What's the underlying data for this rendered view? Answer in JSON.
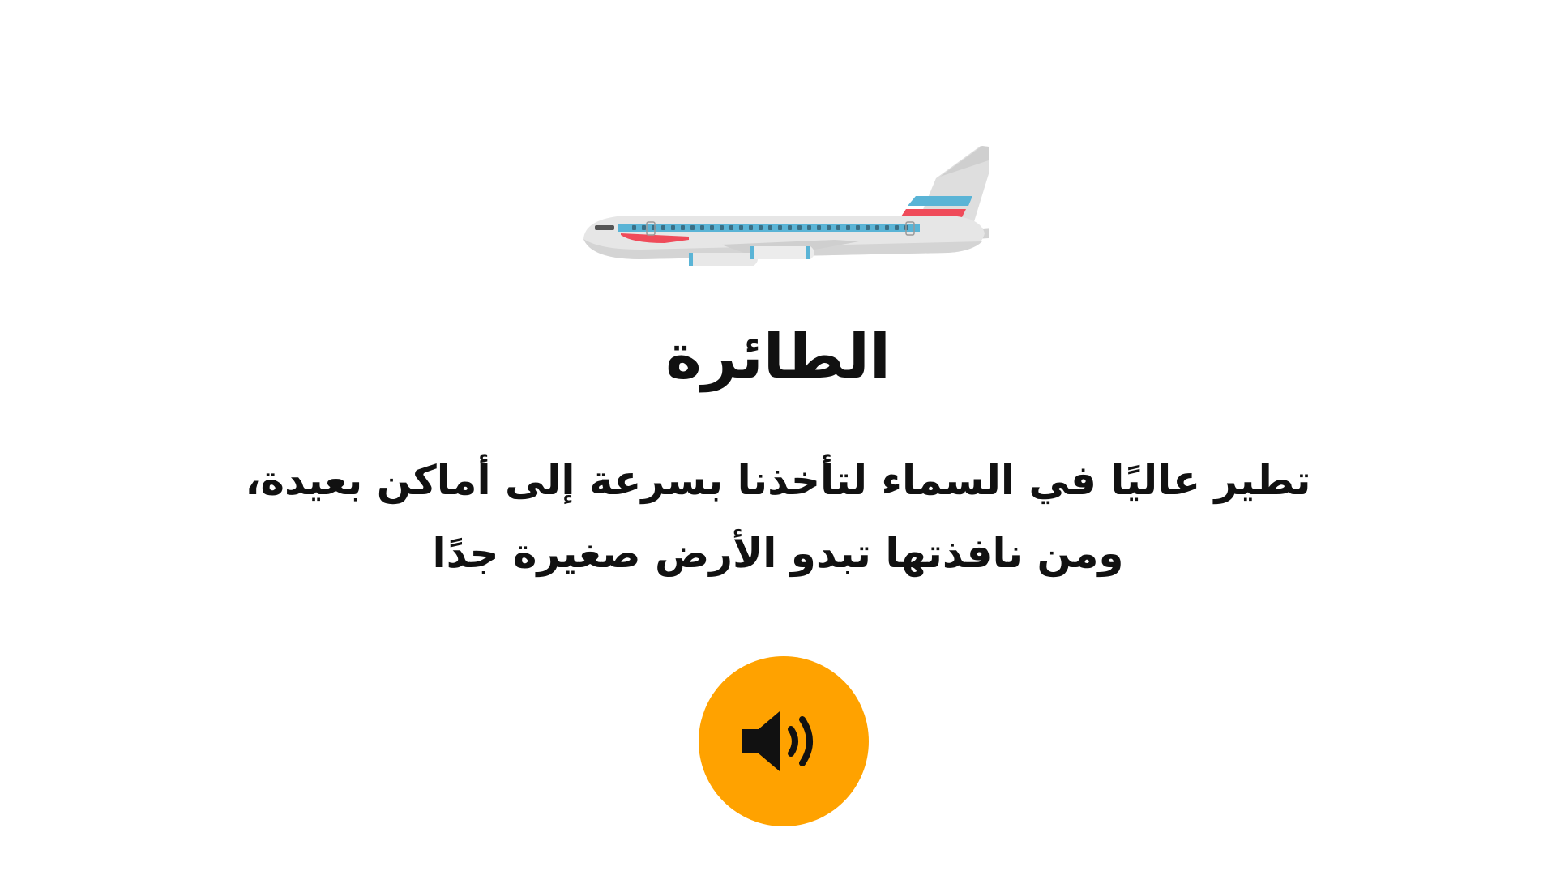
{
  "title": "الطائرة",
  "body_lines": [
    "تطير عاليًا في السماء لتأخذنا بسرعة إلى أماكن بعيدة،",
    "ومن نافذتها تبدو الأرض صغيرة جدًا"
  ],
  "icons": {
    "illustration": "airplane-icon",
    "audio": "speaker-icon"
  },
  "colors": {
    "audio_button": "#ffa200",
    "airplane_body": "#e3e3e3",
    "airplane_stripe_blue": "#5ab4d6",
    "airplane_stripe_red": "#ef4b5a"
  }
}
